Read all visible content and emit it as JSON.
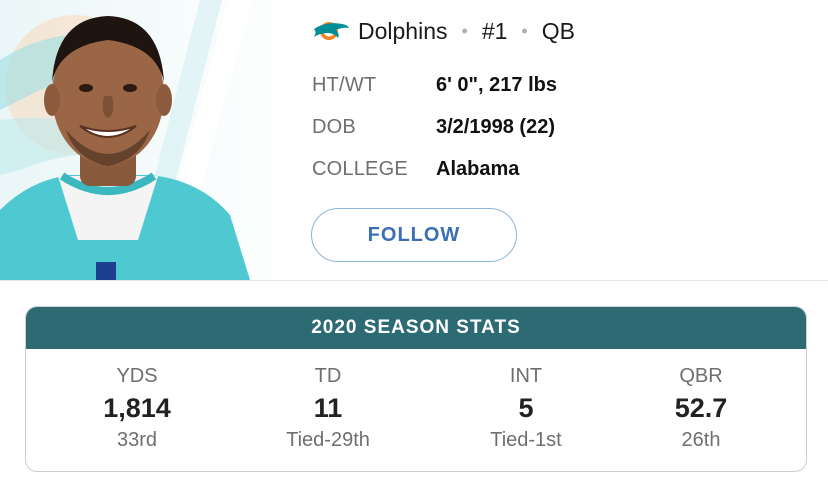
{
  "player": {
    "team": "Dolphins",
    "number": "#1",
    "position": "QB",
    "separator": "•",
    "team_logo_icon": "dolphins-logo-icon"
  },
  "info": [
    {
      "label": "HT/WT",
      "value": "6' 0\", 217 lbs"
    },
    {
      "label": "DOB",
      "value": "3/2/1998 (22)"
    },
    {
      "label": "COLLEGE",
      "value": "Alabama"
    }
  ],
  "follow_label": "FOLLOW",
  "stats": {
    "title": "2020 SEASON STATS",
    "items": [
      {
        "label": "YDS",
        "value": "1,814",
        "rank": "33rd"
      },
      {
        "label": "TD",
        "value": "11",
        "rank": "Tied-29th"
      },
      {
        "label": "INT",
        "value": "5",
        "rank": "Tied-1st"
      },
      {
        "label": "QBR",
        "value": "52.7",
        "rank": "26th"
      }
    ]
  },
  "colors": {
    "stats_header_bg": "#2d6b74",
    "follow_text": "#3a6fb5",
    "dolphins_aqua": "#3cc7cf",
    "dolphins_orange": "#f58220"
  }
}
